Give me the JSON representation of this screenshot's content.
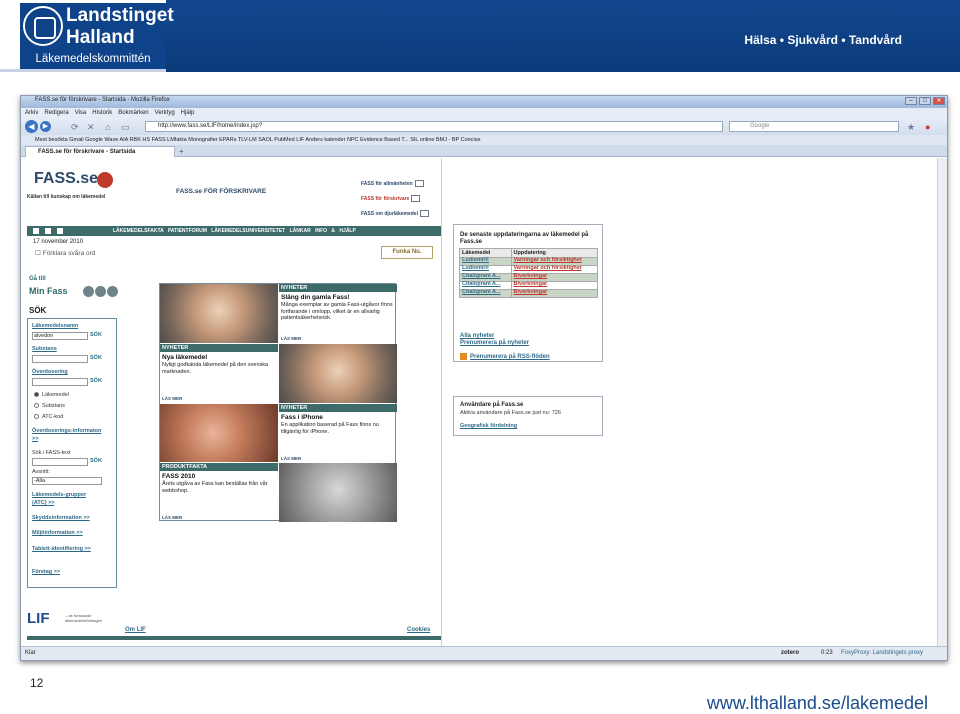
{
  "slide": {
    "logo_line1": "Landstinget",
    "logo_line2": "Halland",
    "logo_line3": "Läkemedelskommittén",
    "tagline": "Hälsa • Sjukvård • Tandvård",
    "page_number": "12",
    "footer_url": "www.lthalland.se/lakemedel"
  },
  "browser": {
    "window_title": "FASS.se för förskrivare - Startsida - Mozilla Firefox",
    "menu": [
      "Arkiv",
      "Redigera",
      "Visa",
      "Historik",
      "Bokmärken",
      "Verktyg",
      "Hjälp"
    ],
    "url": "http://www.fass.se/LIF/home/index.jsp?",
    "search_placeholder": "Google",
    "bookmarks": "Mest besökta  Gmail  Google Wave  AIA  RBK  HS  FASS  LMfakta  Monografier  EPARs  TLV-LM  SAOL  PubMed  LIF  Anders kalender  NPC Evidence Based T...  SIL online  BMJ - BP  Concise",
    "tab_label": "FASS.se för förskrivare - Startsida",
    "status_left": "Klar",
    "status_zotero": "zotero",
    "status_time": "0:23",
    "status_proxy": "FoxyProxy: Landstingets proxy"
  },
  "fass": {
    "logo": "FASS.se",
    "slogan": "Källan till kunskap om läkemedel",
    "section_title": "FASS.se FÖR FÖRSKRIVARE",
    "top_links": [
      "FASS för allmänheten",
      "FASS för förskrivare",
      "FASS om djurläkemedel"
    ],
    "nav": "LÄKEMEDELSFAKTA  PATIENTFORUM  LÄKEMEDELSUNIVERSITETET  LÄNKAR  INFO & HJÄLP",
    "date": "17 november 2010",
    "explain": "Förklara svåra ord",
    "funka": "Funka Nu.",
    "goto": "Gå till",
    "minfass": "Min Fass",
    "search_title": "SÖK",
    "search": {
      "lakemedelsnamn": "Läkemedelsnamn",
      "lakemedelsnamn_value": "alvedon",
      "go": "SÖK",
      "substans": "Substans",
      "overdosering": "Överdosering",
      "radio": [
        "Läkemedel",
        "Substans",
        "ATC-kod"
      ],
      "overdos_info": "Överdoserings-informaton >>",
      "sok_text": "Sök i FASS-text",
      "avsnitt": "Avsnitt:",
      "avsnitt_value": "-Alla",
      "grupper": "Läkemedels-grupper (ATC) >>",
      "skydd": "Skyddsinformation >>",
      "miljo": "Miljöinformation >>",
      "tablett": "Tablett-identifiering >>",
      "foretag": "Företag >>"
    },
    "promo": [
      {
        "caption": "NYHETER",
        "title": "Släng din gamla Fass!",
        "text": "Många exemplar av gamla Fass-utgåvor finns fortfarande i omlopp, vilket är en allvarlig patientsäkerhetsrisk.",
        "more": "LÄS MER"
      },
      {
        "caption": "NYHETER",
        "title": "Nya läkemedel",
        "text": "Nyligt godkända läkemedel på den svenska marknaden.",
        "more": "LÄS MER"
      },
      {
        "caption": "NYHETER",
        "title": "Fass i iPhone",
        "text": "En applikation baserad på Fass finns nu tillgänlig för iPhone.",
        "more": "LÄS MER"
      },
      {
        "caption": "PRODUKTFAKTA",
        "title": "FASS 2010",
        "text": "Årets utgåva av Fass kan beställas från vår webbshop.",
        "more": "LÄS MER"
      }
    ],
    "updates": {
      "title": "De senaste uppdateringarna av läkemedel på Fass.se",
      "col1": "Läkemedel",
      "col2": "Uppdatering",
      "rows": [
        [
          "Ludiomil®",
          "Varningar och försiktighet"
        ],
        [
          "Ludiomil®",
          "Varningar och försiktighet"
        ],
        [
          "Citalopram A...",
          "Biverkningar"
        ],
        [
          "Citalopram A...",
          "Biverkningar"
        ],
        [
          "Citalopram A...",
          "Biverkningar"
        ]
      ],
      "link1": "Alla nyheter",
      "link2": "Prenumerera på nyheter",
      "rss": "Prenumerera på RSS-flöden"
    },
    "users": {
      "title": "Användare på Fass.se",
      "count": "Aktiva användare på Fass.se just nu: 726",
      "link": "Geografisk fördelning"
    },
    "lif": "LIF",
    "lif_tag": "– de forskande läkemedelsföretagen",
    "om_lif": "Om LIF",
    "cookies": "Cookies"
  }
}
